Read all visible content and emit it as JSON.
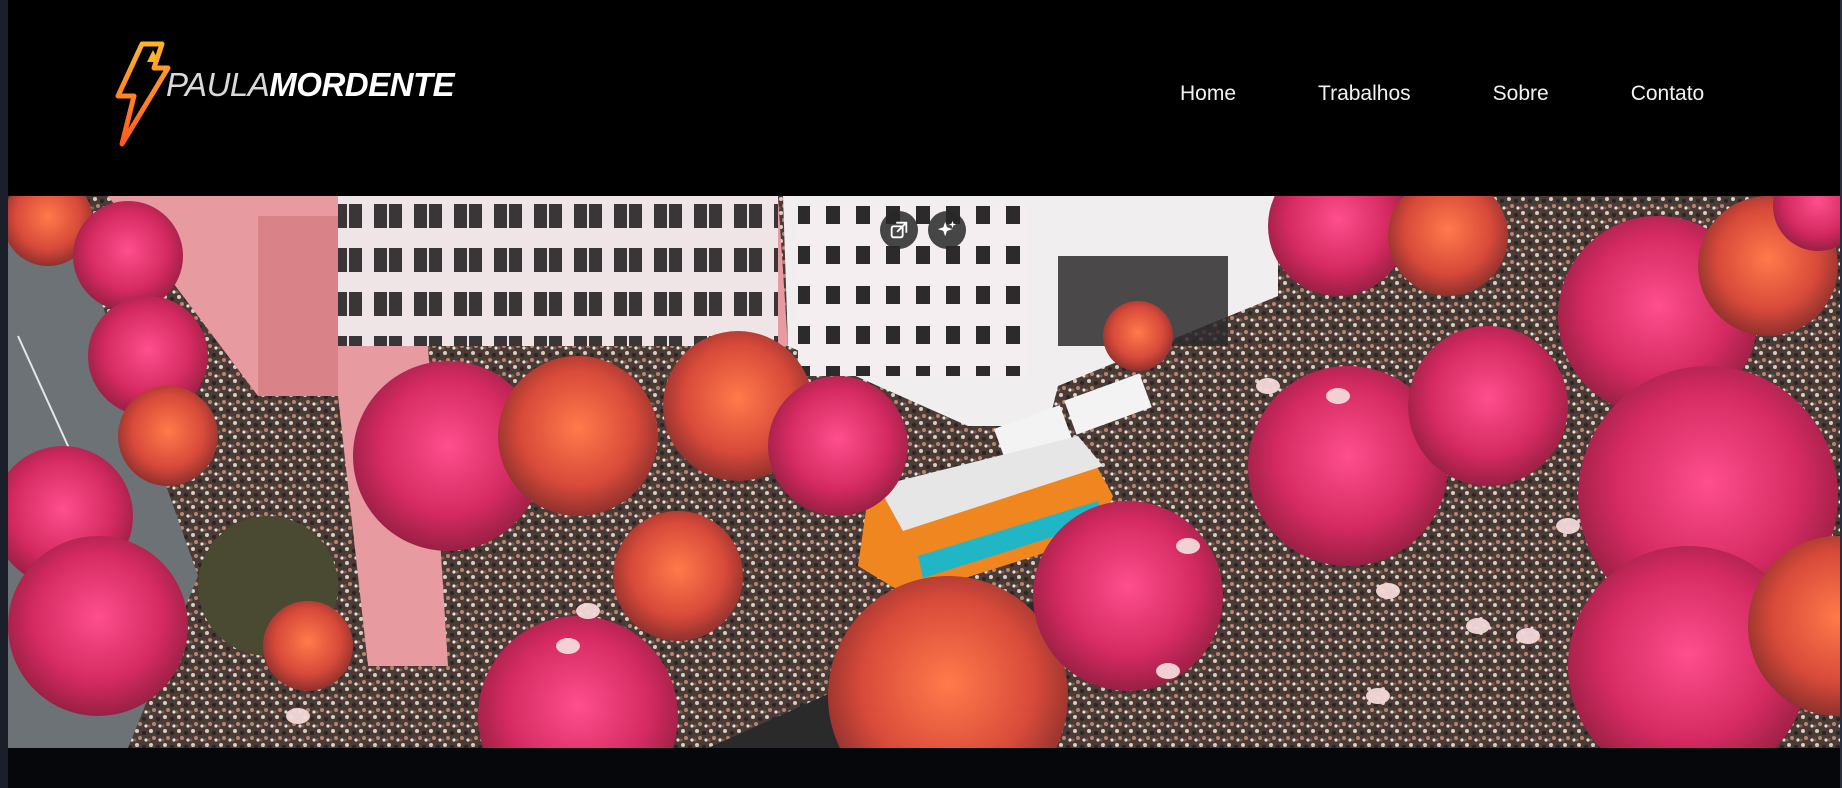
{
  "brand": {
    "name_light": "PAULA",
    "name_bold": "MORDENTE",
    "logo_icon": "lightning-bolt-icon",
    "accent_color": "#f5a623"
  },
  "nav": {
    "items": [
      {
        "label": "Home"
      },
      {
        "label": "Trabalhos"
      },
      {
        "label": "Sobre"
      },
      {
        "label": "Contato"
      }
    ]
  },
  "hero": {
    "image_subject": "aerial photo of a crowded street carnival with pink flowering trees and white buildings",
    "overlay_buttons": [
      {
        "icon": "open-external-icon"
      },
      {
        "icon": "sparkle-icon"
      }
    ]
  }
}
